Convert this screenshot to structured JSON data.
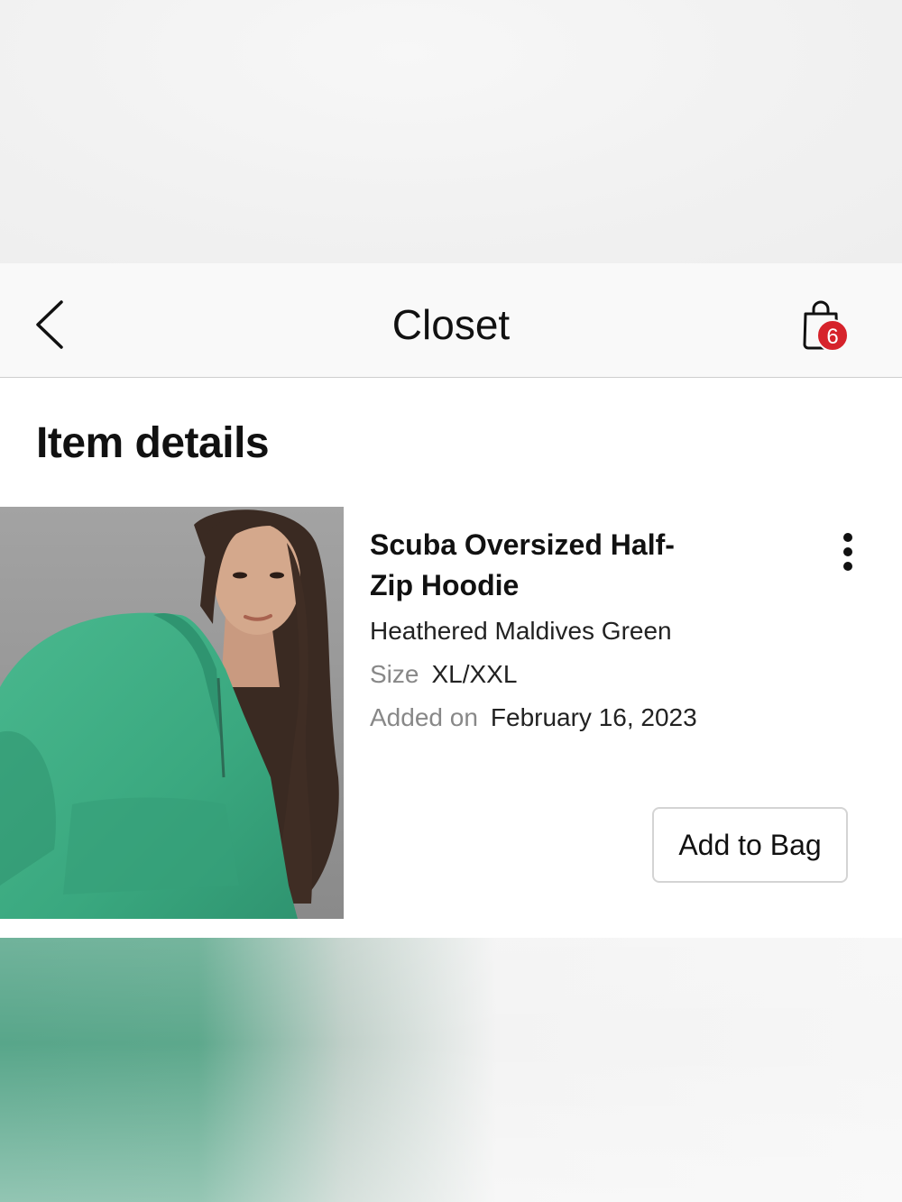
{
  "header": {
    "title": "Closet",
    "back_icon": "chevron-left-icon",
    "bag_icon": "shopping-bag-icon",
    "bag_count": "6",
    "badge_color": "#d6232b"
  },
  "page": {
    "section_title": "Item details"
  },
  "item": {
    "name": "Scuba Oversized Half-Zip Hoodie",
    "color": "Heathered Maldives Green",
    "size_label": "Size",
    "size_value": "XL/XXL",
    "added_label": "Added on",
    "added_value": "February 16, 2023",
    "more_icon": "more-vertical-icon",
    "image_subject": "product-photo",
    "garment_color": "#3fb087",
    "add_to_bag_label": "Add to Bag"
  }
}
